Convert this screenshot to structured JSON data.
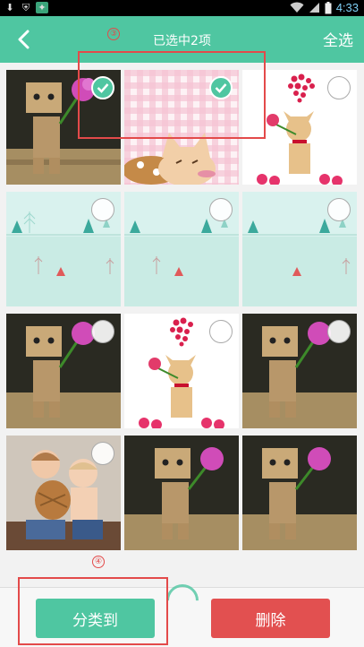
{
  "status_bar": {
    "time": "4:33"
  },
  "header": {
    "title": "已选中2项",
    "select_all_label": "全选"
  },
  "annotations": {
    "label_3": "③",
    "label_4": "④"
  },
  "colors": {
    "accent": "#4fc6a1",
    "danger": "#e25050",
    "annotation": "#e34a4a"
  },
  "photos": [
    {
      "subject": "danbo-rose",
      "selected": true
    },
    {
      "subject": "pink-check-cat",
      "selected": true
    },
    {
      "subject": "chihuahua-hearts",
      "selected": false
    },
    {
      "subject": "mint-trees",
      "selected": false
    },
    {
      "subject": "mint-trees",
      "selected": false
    },
    {
      "subject": "mint-trees",
      "selected": false
    },
    {
      "subject": "danbo-rose",
      "selected": false
    },
    {
      "subject": "chihuahua-hearts",
      "selected": false
    },
    {
      "subject": "danbo-rose",
      "selected": false
    },
    {
      "subject": "children-hug",
      "selected": false
    },
    {
      "subject": "danbo-rose",
      "selected": false
    },
    {
      "subject": "danbo-rose",
      "selected": false
    }
  ],
  "bottom_bar": {
    "classify_label": "分类到",
    "delete_label": "删除"
  }
}
